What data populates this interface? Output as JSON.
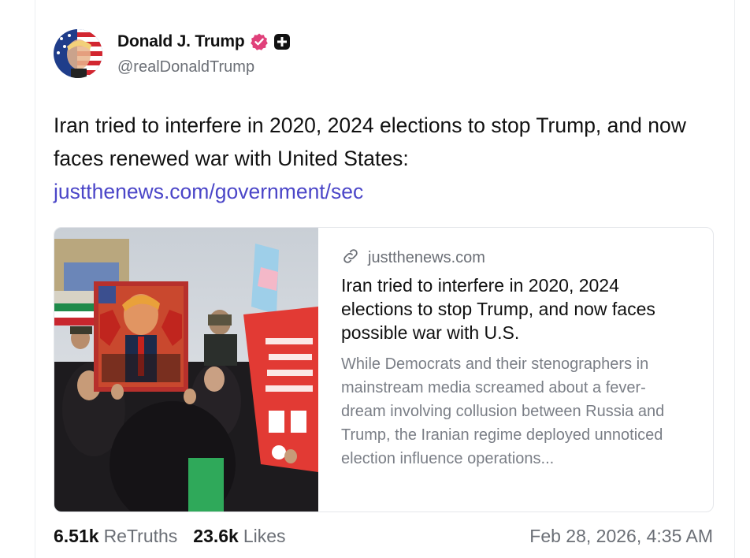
{
  "author": {
    "display_name": "Donald J. Trump",
    "handle": "@realDonaldTrump",
    "avatar": "avatar-flag-portrait",
    "verified_icon": "verified-badge-icon",
    "plus_icon": "plus-badge-icon"
  },
  "post": {
    "text": "Iran tried to interfere in 2020, 2024 elections to stop Trump, and now faces renewed war with United States:",
    "link": "justthenews.com/government/sec"
  },
  "preview": {
    "domain": "justthenews.com",
    "domain_icon": "link-icon",
    "title": "Iran tried to interfere in 2020, 2024 elections to stop Trump, and now faces possible war with U.S.",
    "description": "While Democrats and their stenographers in mainstream media screamed about a fever-dream involving collusion between Russia and Trump, the Iranian regime deployed unnoticed election influence operations...",
    "image": "protest-photo"
  },
  "stats": {
    "retruths_value": "6.51k",
    "retruths_label": "ReTruths",
    "likes_value": "23.6k",
    "likes_label": "Likes"
  },
  "timestamp": "Feb 28, 2026, 4:35 AM",
  "colors": {
    "link": "#4b46c8",
    "verified": "#e0407a",
    "muted": "#6b6f76"
  }
}
